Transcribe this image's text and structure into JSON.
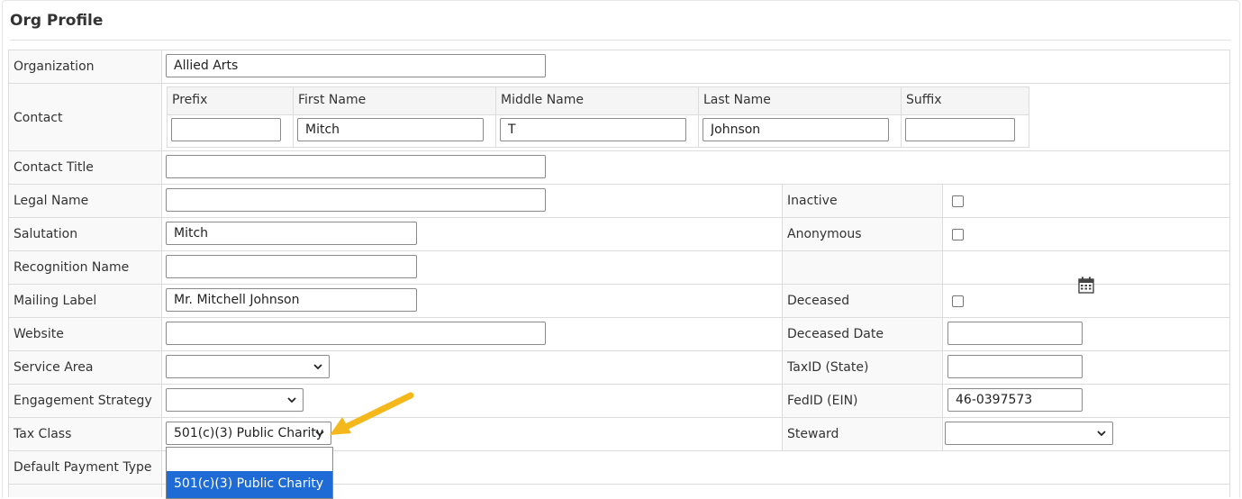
{
  "page": {
    "title": "Org Profile"
  },
  "fields": {
    "organization": {
      "label": "Organization",
      "value": "Allied Arts"
    },
    "contact": {
      "label": "Contact",
      "prefix": {
        "label": "Prefix",
        "value": ""
      },
      "first_name": {
        "label": "First Name",
        "value": "Mitch"
      },
      "middle_name": {
        "label": "Middle Name",
        "value": "T"
      },
      "last_name": {
        "label": "Last Name",
        "value": "Johnson"
      },
      "suffix": {
        "label": "Suffix",
        "value": ""
      }
    },
    "contact_title": {
      "label": "Contact Title",
      "value": ""
    },
    "legal_name": {
      "label": "Legal Name",
      "value": ""
    },
    "salutation": {
      "label": "Salutation",
      "value": "Mitch"
    },
    "recognition_name": {
      "label": "Recognition Name",
      "value": ""
    },
    "mailing_label": {
      "label": "Mailing Label",
      "value": "Mr. Mitchell Johnson"
    },
    "website": {
      "label": "Website",
      "value": ""
    },
    "service_area": {
      "label": "Service Area",
      "value": ""
    },
    "engagement_strategy": {
      "label": "Engagement Strategy",
      "value": ""
    },
    "tax_class": {
      "label": "Tax Class",
      "value": "501(c)(3) Public Charity",
      "options": [
        "",
        "501(c)(3) Public Charity"
      ],
      "highlighted_option": "501(c)(3) Public Charity"
    },
    "default_payment_type": {
      "label": "Default Payment Type"
    },
    "inactive": {
      "label": "Inactive",
      "checked": false
    },
    "anonymous": {
      "label": "Anonymous",
      "checked": false
    },
    "deceased": {
      "label": "Deceased",
      "checked": false
    },
    "deceased_date": {
      "label": "Deceased Date",
      "value": ""
    },
    "taxid_state": {
      "label": "TaxID (State)",
      "value": ""
    },
    "fedid_ein": {
      "label": "FedID (EIN)",
      "value": "46-0397573"
    },
    "steward": {
      "label": "Steward",
      "value": ""
    }
  },
  "icons": {
    "calendar": "calendar-icon",
    "chevron": "chevron-down-icon",
    "annotation": "arrow-annotation"
  },
  "colors": {
    "highlight": "#1e6bd6",
    "arrow": "#f5b81c",
    "border": "#dcdcdc"
  }
}
